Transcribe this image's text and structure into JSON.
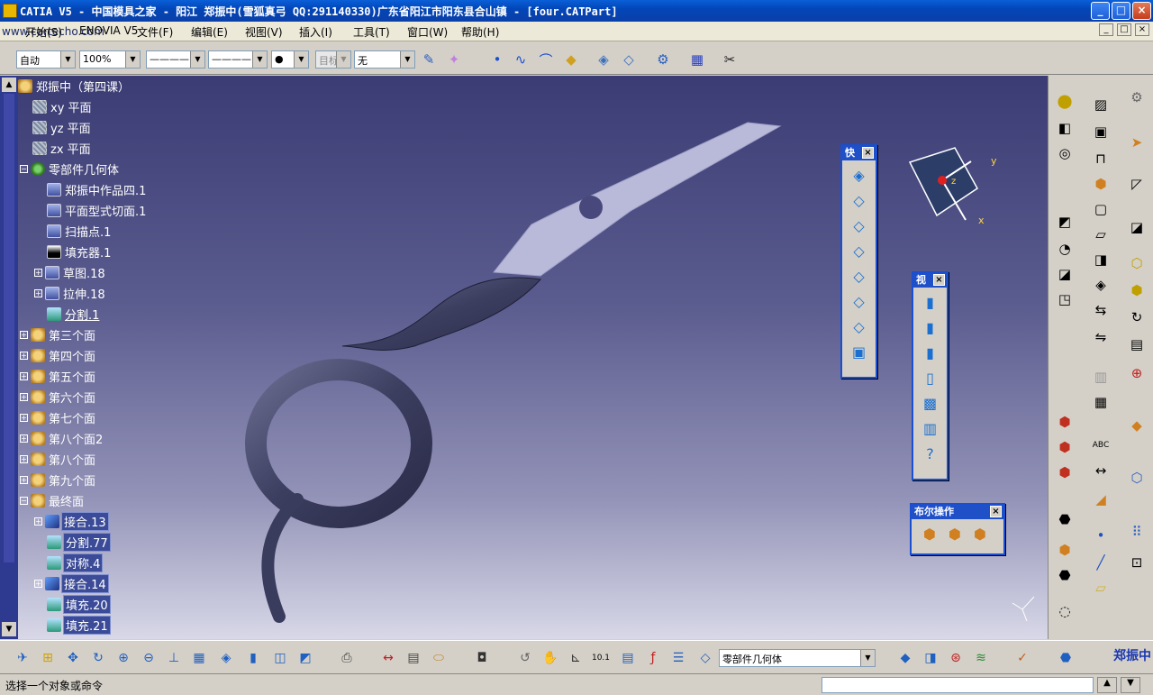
{
  "window": {
    "title": "CATIA V5 - 中国模具之家 - 阳江    郑振中(雪狐真弓 QQ:291140330)广东省阳江市阳东县合山镇 - [four.CATPart]",
    "watermark": "中国模具之家",
    "minimize": "_",
    "maximize": "□",
    "close": "×"
  },
  "menubar": {
    "site": "www.cartecho.com",
    "items": [
      "开始(S)",
      "ENOVIA V5",
      "文件(F)",
      "编辑(E)",
      "视图(V)",
      "插入(I)",
      "工具(T)",
      "窗口(W)",
      "帮助(H)"
    ],
    "mdi": [
      "_",
      "□",
      "×"
    ]
  },
  "toolbar": {
    "color_combo": "自动",
    "transparency_combo": "100%",
    "linetype_combo": "————",
    "thickness_combo": "————",
    "point_combo": "●",
    "layer_combo": "目标",
    "rendering_combo": "无"
  },
  "tree": {
    "root": "郑振中（第四课）",
    "nodes": [
      {
        "label": "xy 平面",
        "icon": "plane"
      },
      {
        "label": "yz 平面",
        "icon": "plane"
      },
      {
        "label": "zx 平面",
        "icon": "plane"
      },
      {
        "label": "零部件几何体",
        "icon": "gear"
      },
      {
        "label": "郑振中作品四.1",
        "icon": "part"
      },
      {
        "label": "平面型式切面.1",
        "icon": "part"
      },
      {
        "label": "扫描点.1",
        "icon": "part"
      },
      {
        "label": "填充器.1",
        "icon": "fill"
      },
      {
        "label": "草图.18",
        "icon": "part"
      },
      {
        "label": "拉伸.18",
        "icon": "part"
      },
      {
        "label": "分割.1",
        "icon": "green"
      },
      {
        "label": "第三个面",
        "icon": "face"
      },
      {
        "label": "第四个面",
        "icon": "face"
      },
      {
        "label": "第五个面",
        "icon": "face"
      },
      {
        "label": "第六个面",
        "icon": "face"
      },
      {
        "label": "第七个面",
        "icon": "face"
      },
      {
        "label": "第八个面2",
        "icon": "face"
      },
      {
        "label": "第八个面",
        "icon": "face"
      },
      {
        "label": "第九个面",
        "icon": "face"
      },
      {
        "label": "最终面",
        "icon": "face"
      },
      {
        "label": "接合.13",
        "icon": "join"
      },
      {
        "label": "分割.77",
        "icon": "green"
      },
      {
        "label": "对称.4",
        "icon": "green"
      },
      {
        "label": "接合.14",
        "icon": "join"
      },
      {
        "label": "填充.20",
        "icon": "green"
      },
      {
        "label": "填充.21",
        "icon": "green"
      }
    ]
  },
  "floating": {
    "quick_view": {
      "title": "快",
      "close": "×"
    },
    "view_mode": {
      "title": "视",
      "close": "×"
    },
    "boolean": {
      "title": "布尔操作",
      "close": "×"
    }
  },
  "compass": {
    "x": "x",
    "y": "y",
    "z": "z"
  },
  "bottom": {
    "body_combo": "零部件几何体",
    "workbench": "郑振中"
  },
  "status": {
    "message": "选择一个对象或命令"
  },
  "colors": {
    "titlebar": "#0346b8",
    "viewport_top": "#3b3c74",
    "viewport_bottom": "#d8d8e8",
    "part": "#4a4c6e",
    "blade": "#b8b8d8"
  }
}
